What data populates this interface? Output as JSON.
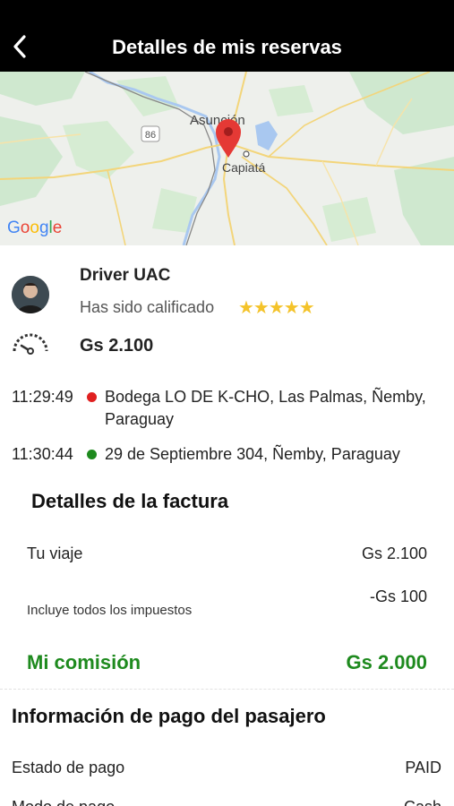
{
  "header": {
    "title": "Detalles de mis reservas"
  },
  "map": {
    "labels": {
      "city1": "Asunción",
      "city2": "Capiatá",
      "route": "86"
    },
    "attribution": "Google",
    "pin_color": "#e53935"
  },
  "driver": {
    "name": "Driver UAC",
    "rated_text": "Has sido calificado",
    "stars": "★★★★★",
    "rating": 5,
    "fare": "Gs 2.100"
  },
  "stops": [
    {
      "time": "11:29:49",
      "address": "Bodega LO DE K-CHO, Las Palmas, Ñemby, Paraguay",
      "dot_color": "#e02020"
    },
    {
      "time": "11:30:44",
      "address": "29 de Septiembre 304, Ñemby, Paraguay",
      "dot_color": "#1e8a1e"
    }
  ],
  "invoice": {
    "title": "Detalles de la factura",
    "trip_label": "Tu viaje",
    "trip_value": "Gs 2.100",
    "discount_value": "-Gs 100",
    "taxes_label": "Incluye todos los impuestos",
    "commission_label": "Mi comisión",
    "commission_value": "Gs 2.000",
    "commission_color": "#1e8a1e"
  },
  "payment": {
    "title": "Información de pago del pasajero",
    "status_label": "Estado de pago",
    "status_value": "PAID",
    "method_label": "Modo de pago",
    "method_value": "Cash"
  }
}
